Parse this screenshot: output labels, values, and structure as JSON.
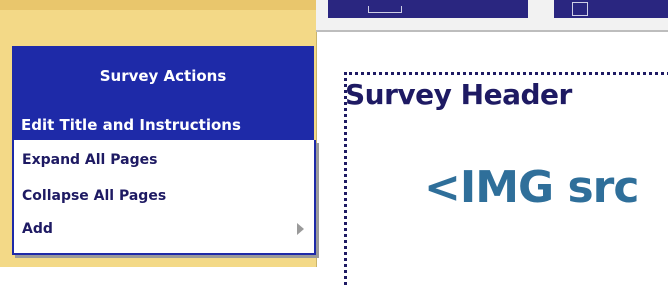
{
  "survey_actions": {
    "title": "Survey Actions",
    "items": [
      {
        "label": "Edit Title and Instructions",
        "selected": true
      },
      {
        "label": "Expand All Pages"
      },
      {
        "label": "Collapse All Pages"
      },
      {
        "label": "Add",
        "has_submenu": true
      }
    ]
  },
  "canvas": {
    "header": "Survey Header",
    "img_text": "<IMG src"
  },
  "colors": {
    "sidebar": "#f3d987",
    "accent_blue": "#1e2aa8",
    "dark_navy": "#1e1a63",
    "img_text": "#2f6f9a"
  }
}
